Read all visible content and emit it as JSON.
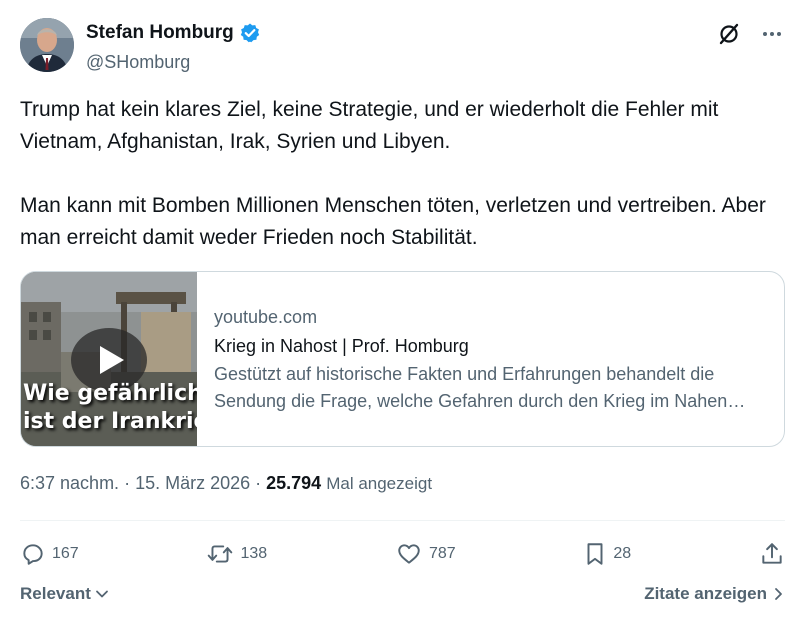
{
  "author": {
    "name": "Stefan Homburg",
    "handle": "@SHomburg"
  },
  "tweet": {
    "paragraphs": [
      "Trump hat kein klares Ziel, keine Strategie, und er wiederholt die Fehler mit Vietnam, Afghanistan, Irak, Syrien und Libyen.",
      "Man kann mit Bomben Millionen Menschen töten, verletzen und vertreiben. Aber man erreicht damit weder Frieden noch Stabilität."
    ]
  },
  "link_card": {
    "domain": "youtube.com",
    "title": "Krieg in Nahost | Prof. Homburg",
    "description": "Gestützt auf historische Fakten und Erfahrungen behandelt die Sendung die Frage, welche Gefahren durch den Krieg im Nahen Osten drohen.",
    "thumbnail_text": [
      "Wie gefährlich",
      "ist der Irankrieg"
    ]
  },
  "meta": {
    "time": "6:37 nachm.",
    "separator": "·",
    "date": "15. März 2026",
    "views": "25.794",
    "views_label": "Mal angezeigt"
  },
  "actions": {
    "replies": "167",
    "reposts": "138",
    "likes": "787",
    "bookmarks": "28"
  },
  "footer": {
    "sort_label": "Relevant",
    "quotes_label": "Zitate anzeigen"
  },
  "icons": {
    "verified": "verified-badge-icon",
    "grok": "grok-icon",
    "more": "more-icon",
    "play": "play-icon",
    "reply": "reply-icon",
    "repost": "repost-icon",
    "like": "like-icon",
    "bookmark": "bookmark-icon",
    "share": "share-icon"
  },
  "colors": {
    "verified_blue": "#1d9bf0",
    "secondary_text": "#536471",
    "border": "#cfd9de",
    "primary_text": "#0f1419"
  }
}
